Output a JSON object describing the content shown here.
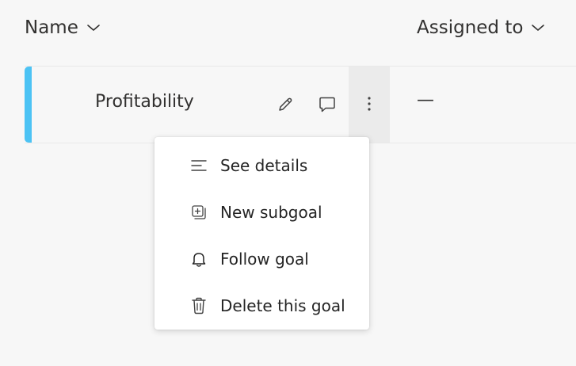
{
  "table": {
    "columns": [
      {
        "label": "Name",
        "icon": "chevron-down-icon"
      },
      {
        "label": "Assigned to",
        "icon": "chevron-down-icon"
      }
    ],
    "rows": [
      {
        "name": "Profitability",
        "assigned_to": "—",
        "accent_color": "#4cc3f4",
        "actions": [
          "pencil-icon",
          "comment-icon",
          "more-vertical-icon"
        ]
      }
    ]
  },
  "context_menu": {
    "items": [
      {
        "label": "See details",
        "icon": "details-lines-icon"
      },
      {
        "label": "New subgoal",
        "icon": "add-subgoal-icon"
      },
      {
        "label": "Follow goal",
        "icon": "bell-icon"
      },
      {
        "label": "Delete this goal",
        "icon": "trash-icon"
      }
    ]
  }
}
